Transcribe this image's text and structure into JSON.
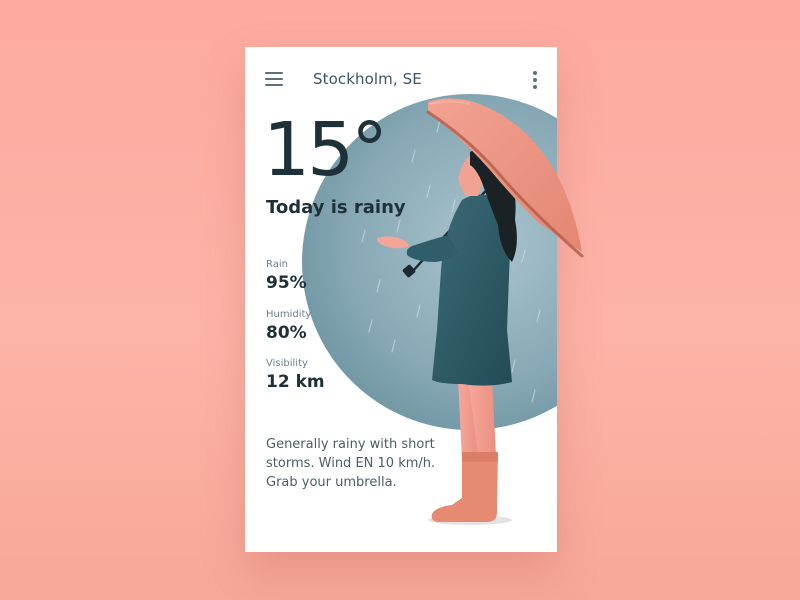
{
  "header": {
    "location": "Stockholm, SE"
  },
  "weather": {
    "temperature": "15°",
    "condition": "Today is rainy",
    "stats": [
      {
        "label": "Rain",
        "value": "95%"
      },
      {
        "label": "Humidity",
        "value": "80%"
      },
      {
        "label": "Visibility",
        "value": "12 km"
      }
    ],
    "description": "Generally rainy with short storms. Wind EN 10 km/h. Grab your umbrella."
  },
  "colors": {
    "background": "#fdaaa0",
    "card": "#ffffff",
    "text_dark": "#1e3038",
    "circle": "#8fb0bd",
    "coat": "#2e5a66",
    "umbrella": "#e8907e"
  },
  "icons": {
    "menu": "hamburger-menu-icon",
    "more": "vertical-dots-icon"
  }
}
